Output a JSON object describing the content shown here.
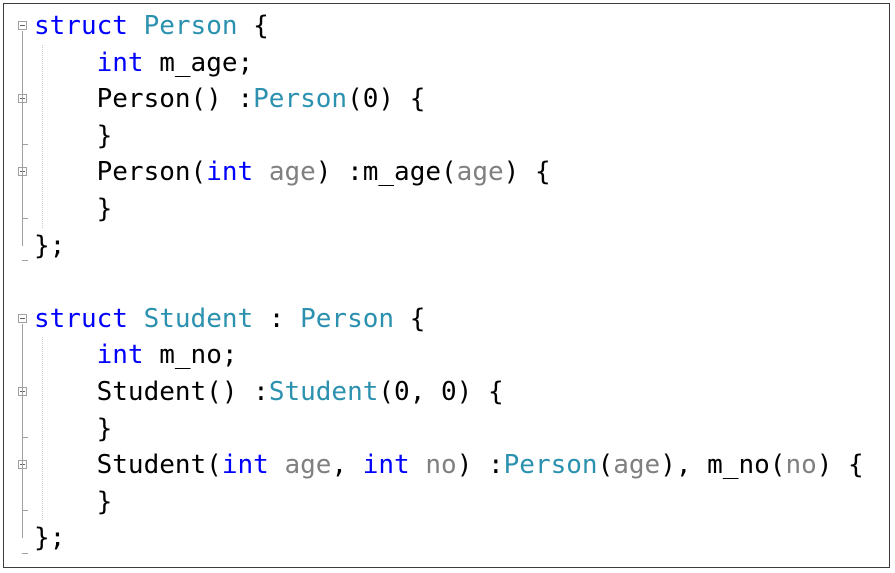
{
  "editor": {
    "colors": {
      "keyword": "#0000ff",
      "type": "#2b91af",
      "parameter": "#808080",
      "text": "#000000"
    },
    "lines": [
      [
        [
          "kw",
          "struct"
        ],
        [
          "pl",
          " "
        ],
        [
          "ty",
          "Person"
        ],
        [
          "pl",
          " {"
        ]
      ],
      [
        [
          "pl",
          "    "
        ],
        [
          "kw",
          "int"
        ],
        [
          "pl",
          " m_age;"
        ]
      ],
      [
        [
          "pl",
          "    Person() :"
        ],
        [
          "ty",
          "Person"
        ],
        [
          "pl",
          "(0) {"
        ]
      ],
      [
        [
          "pl",
          "    }"
        ]
      ],
      [
        [
          "pl",
          "    Person("
        ],
        [
          "kw",
          "int"
        ],
        [
          "pl",
          " "
        ],
        [
          "pa",
          "age"
        ],
        [
          "pl",
          ") :m_age("
        ],
        [
          "pa",
          "age"
        ],
        [
          "pl",
          ") {"
        ]
      ],
      [
        [
          "pl",
          "    }"
        ]
      ],
      [
        [
          "pl",
          "};"
        ]
      ],
      [],
      [
        [
          "kw",
          "struct"
        ],
        [
          "pl",
          " "
        ],
        [
          "ty",
          "Student"
        ],
        [
          "pl",
          " : "
        ],
        [
          "ty",
          "Person"
        ],
        [
          "pl",
          " {"
        ]
      ],
      [
        [
          "pl",
          "    "
        ],
        [
          "kw",
          "int"
        ],
        [
          "pl",
          " m_no;"
        ]
      ],
      [
        [
          "pl",
          "    Student() :"
        ],
        [
          "ty",
          "Student"
        ],
        [
          "pl",
          "(0, 0) {"
        ]
      ],
      [
        [
          "pl",
          "    }"
        ]
      ],
      [
        [
          "pl",
          "    Student("
        ],
        [
          "kw",
          "int"
        ],
        [
          "pl",
          " "
        ],
        [
          "pa",
          "age"
        ],
        [
          "pl",
          ", "
        ],
        [
          "kw",
          "int"
        ],
        [
          "pl",
          " "
        ],
        [
          "pa",
          "no"
        ],
        [
          "pl",
          ") :"
        ],
        [
          "ty",
          "Person"
        ],
        [
          "pl",
          "("
        ],
        [
          "pa",
          "age"
        ],
        [
          "pl",
          "), m_no("
        ],
        [
          "pa",
          "no"
        ],
        [
          "pl",
          ") {"
        ]
      ],
      [
        [
          "pl",
          "    }"
        ]
      ],
      [
        [
          "pl",
          "};"
        ]
      ]
    ],
    "fold_lines": [
      0,
      2,
      4,
      8,
      10,
      12
    ],
    "fold_icon": "collapse-minus-icon"
  }
}
